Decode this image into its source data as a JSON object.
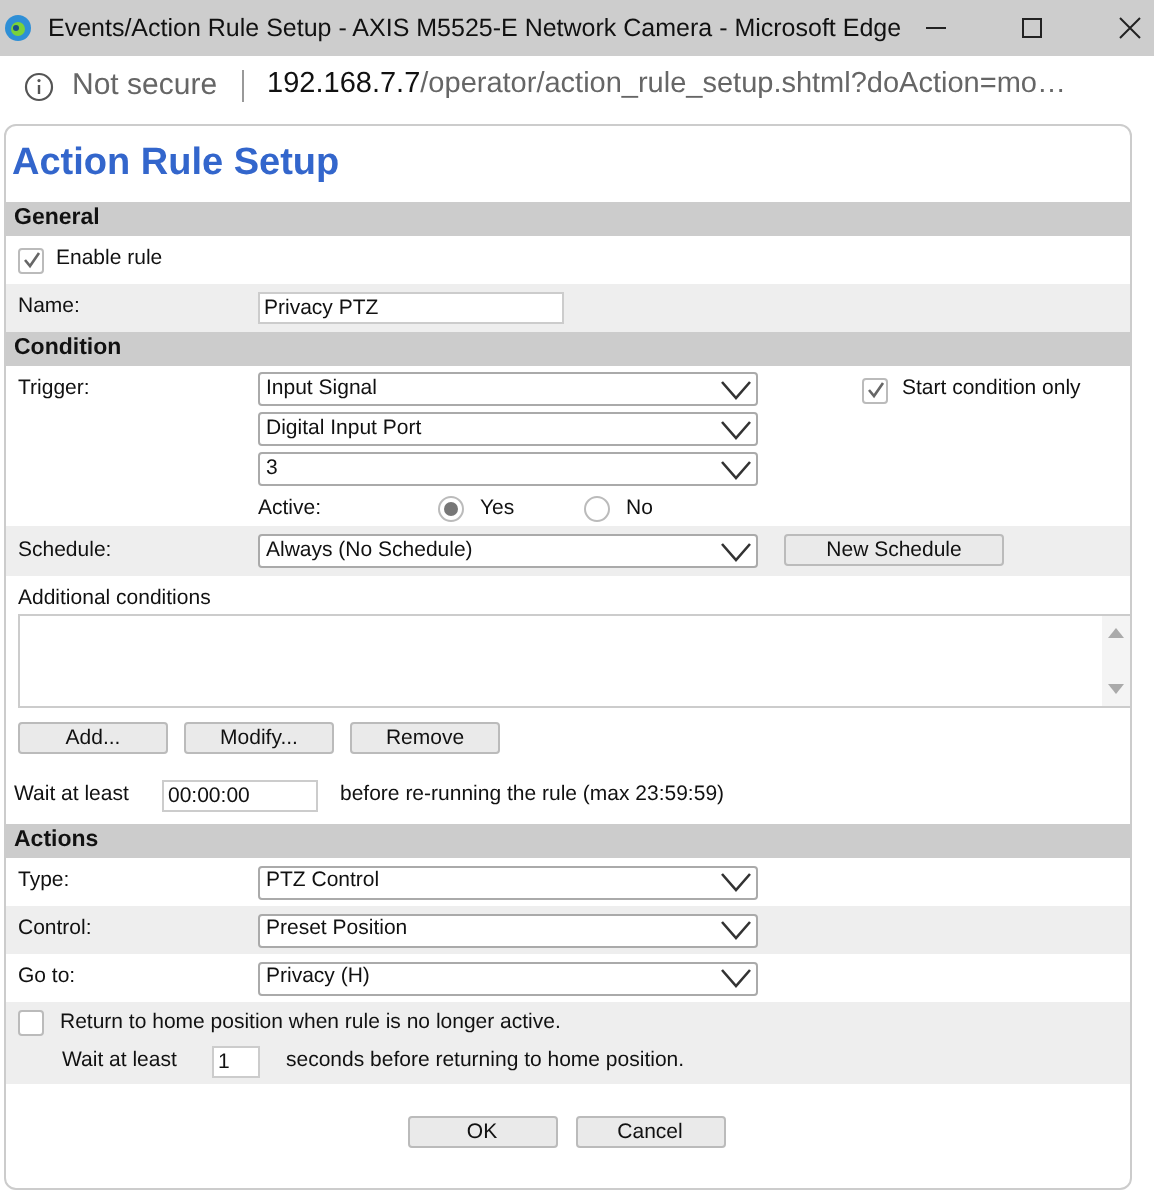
{
  "window": {
    "title": "Events/Action Rule Setup - AXIS M5525-E Network Camera - Microsoft Edge"
  },
  "address_bar": {
    "security": "Not secure",
    "host": "192.168.7.7",
    "path": "/operator/action_rule_setup.shtml?doAction=mo…"
  },
  "heading": "Action Rule Setup",
  "general": {
    "title": "General",
    "enable": {
      "label": "Enable rule",
      "checked": true
    },
    "name": {
      "label": "Name:",
      "value": "Privacy PTZ"
    }
  },
  "condition": {
    "title": "Condition",
    "trigger_label": "Trigger:",
    "trigger_selects": [
      "Input Signal",
      "Digital Input Port",
      "3"
    ],
    "start_only": {
      "label": "Start condition only",
      "checked": true
    },
    "active_label": "Active:",
    "active_options": [
      {
        "label": "Yes",
        "selected": true
      },
      {
        "label": "No",
        "selected": false
      }
    ],
    "schedule": {
      "label": "Schedule:",
      "value": "Always (No Schedule)",
      "button": "New Schedule"
    },
    "additional_label": "Additional conditions",
    "buttons": [
      "Add...",
      "Modify...",
      "Remove"
    ],
    "wait": {
      "label": "Wait at least",
      "value": "00:00:00",
      "note": "before re-running the rule (max 23:59:59)"
    }
  },
  "actions": {
    "title": "Actions",
    "rows": [
      {
        "label": "Type:",
        "value": "PTZ Control"
      },
      {
        "label": "Control:",
        "value": "Preset Position"
      },
      {
        "label": "Go to:",
        "value": "Privacy (H)"
      }
    ],
    "return_home": {
      "label": "Return to home position when rule is no longer active.",
      "checked": false
    },
    "wait": {
      "label": "Wait at least",
      "value": "1",
      "note": "seconds before returning to home position."
    }
  },
  "buttons": [
    "OK",
    "Cancel"
  ]
}
